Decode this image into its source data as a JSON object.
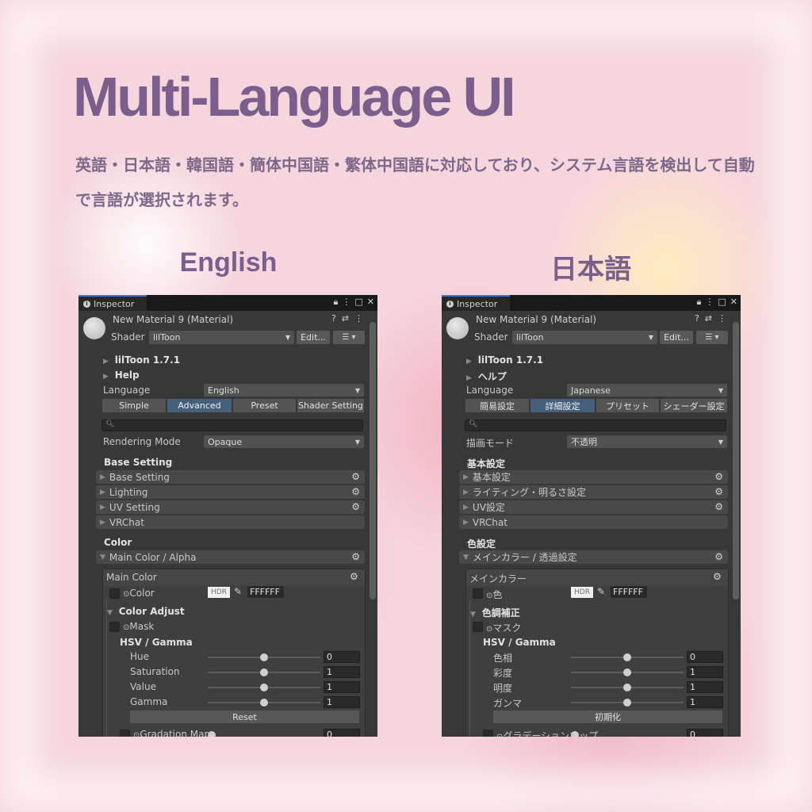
{
  "headline": "Multi-Language UI",
  "description": "英語・日本語・韓国語・簡体中国語・繁体中国語に対応しており、システム言語を検出して自動で言語が選択されます。",
  "panels": {
    "en": {
      "heading": "English",
      "tab": "Inspector",
      "material": "New Material 9 (Material)",
      "shader_label": "Shader",
      "shader_value": "lilToon",
      "edit_label": "Edit...",
      "version": "lilToon 1.7.1",
      "help": "Help",
      "language_label": "Language",
      "language_value": "English",
      "tabs": [
        "Simple",
        "Advanced",
        "Preset",
        "Shader Setting"
      ],
      "rendering_label": "Rendering Mode",
      "rendering_value": "Opaque",
      "base_heading": "Base Setting",
      "sections": [
        "Base Setting",
        "Lighting",
        "UV Setting",
        "VRChat"
      ],
      "color_heading": "Color",
      "main_section": "Main Color / Alpha",
      "box_title": "Main Color",
      "color_label": "Color",
      "hdr": "HDR",
      "hex": "FFFFFF",
      "adjust": "Color Adjust",
      "mask": "Mask",
      "hsv": "HSV / Gamma",
      "sliders": [
        {
          "label": "Hue",
          "value": "0",
          "level": 0.5
        },
        {
          "label": "Saturation",
          "value": "1",
          "level": 0.5
        },
        {
          "label": "Value",
          "value": "1",
          "level": 0.5
        },
        {
          "label": "Gamma",
          "value": "1",
          "level": 0.5
        }
      ],
      "reset": "Reset",
      "gradation": "Gradation Map",
      "gradation_value": "0"
    },
    "ja": {
      "heading": "日本語",
      "tab": "Inspector",
      "material": "New Material 9 (Material)",
      "shader_label": "Shader",
      "shader_value": "lilToon",
      "edit_label": "Edit...",
      "version": "lilToon 1.7.1",
      "help": "ヘルプ",
      "language_label": "Language",
      "language_value": "Japanese",
      "tabs": [
        "簡易設定",
        "詳細設定",
        "プリセット",
        "シェーダー設定"
      ],
      "rendering_label": "描画モード",
      "rendering_value": "不透明",
      "base_heading": "基本設定",
      "sections": [
        "基本設定",
        "ライティング・明るさ設定",
        "UV設定",
        "VRChat"
      ],
      "color_heading": "色設定",
      "main_section": "メインカラー / 透過設定",
      "box_title": "メインカラー",
      "color_label": "色",
      "hdr": "HDR",
      "hex": "FFFFFF",
      "adjust": "色調補正",
      "mask": "マスク",
      "hsv": "HSV / Gamma",
      "sliders": [
        {
          "label": "色相",
          "value": "0",
          "level": 0.5
        },
        {
          "label": "彩度",
          "value": "1",
          "level": 0.5
        },
        {
          "label": "明度",
          "value": "1",
          "level": 0.5
        },
        {
          "label": "ガンマ",
          "value": "1",
          "level": 0.5
        }
      ],
      "reset": "初期化",
      "gradation": "グラデーションマップ",
      "gradation_value": "0"
    }
  }
}
